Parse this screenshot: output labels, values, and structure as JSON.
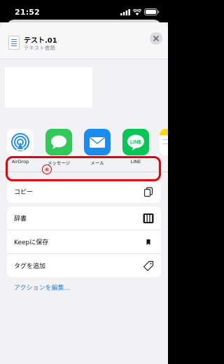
{
  "status": {
    "time": "21:52"
  },
  "file": {
    "name": "テスト.01",
    "kind": "テキスト書類"
  },
  "apps": [
    {
      "label": "AirDrop",
      "icon": "airdrop-icon"
    },
    {
      "label": "メッセージ",
      "icon": "messages-icon"
    },
    {
      "label": "メール",
      "icon": "mail-icon"
    },
    {
      "label": "LINE",
      "icon": "line-icon"
    }
  ],
  "actions": {
    "copy_label": "コピー",
    "copy_step_badge": "⑥",
    "dictionary_label": "辞書",
    "keep_label": "Keepに保存",
    "tag_label": "タグを追加"
  },
  "edit_actions_label": "アクションを編集...",
  "colors": {
    "accent": "#2d7fe8",
    "highlight": "#e8000e"
  }
}
